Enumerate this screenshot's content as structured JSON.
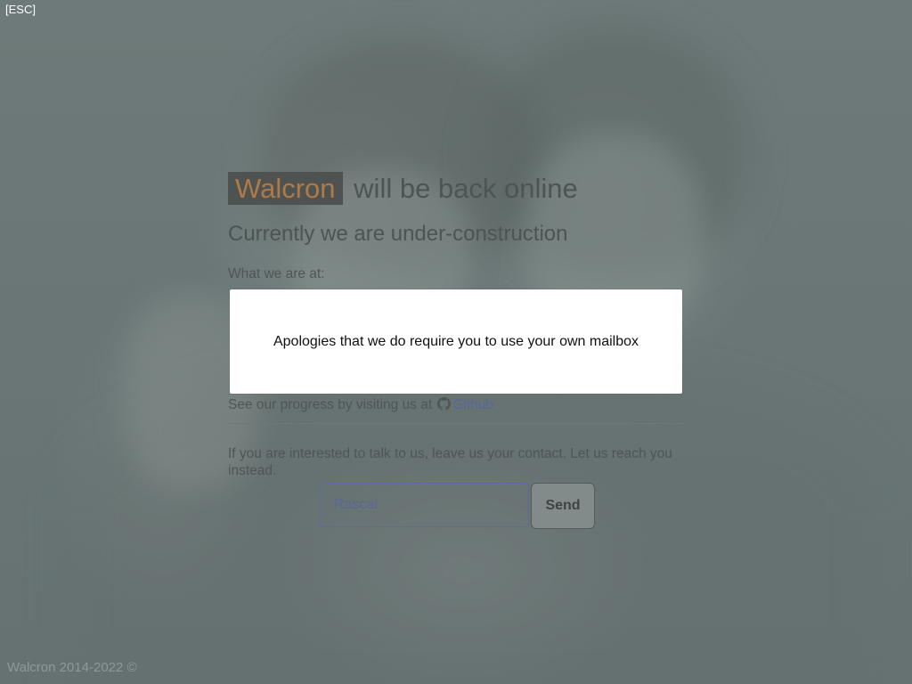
{
  "esc_label": "[ESC]",
  "headline": {
    "brand": "Walcron",
    "rest": "will be back online"
  },
  "subhead": "Currently we are under-construction",
  "what_we_are_at_label": "What we are at:",
  "progress": {
    "prefix": "See our progress by visiting us at",
    "link_label": "Github",
    "icon": "github-icon"
  },
  "contact_text": "If you are interested to talk to us, leave us your contact. Let us reach you instead.",
  "form": {
    "input_placeholder": "Rascal",
    "send_label": "Send"
  },
  "modal": {
    "message": "Apologies that we do require you to use your own mailbox"
  },
  "footer": "Walcron 2014-2022 ©",
  "colors": {
    "brand_text": "#b07a48",
    "brand_bg": "#4e5352",
    "link": "#5a6798",
    "overlay": "#6b7777"
  }
}
